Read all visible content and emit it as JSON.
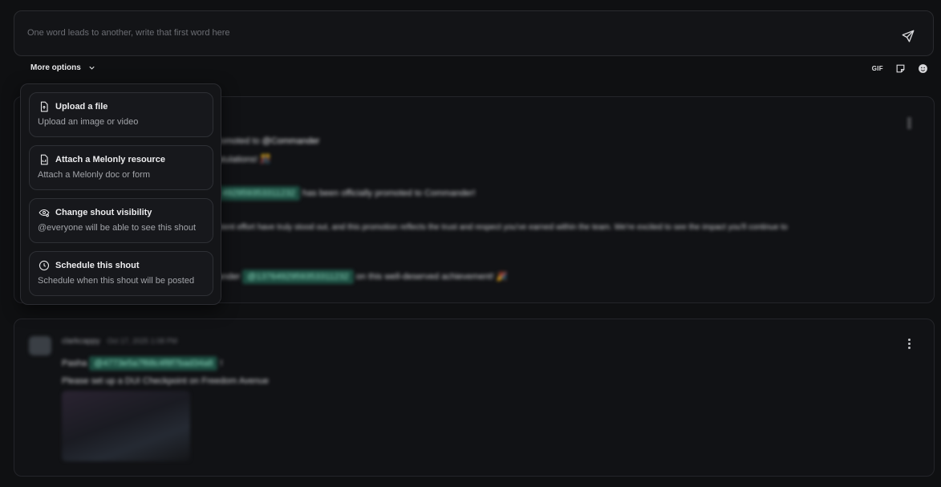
{
  "composer": {
    "placeholder": "One word leads to another, write that first word here"
  },
  "toolbar": {
    "more_options_label": "More options",
    "gif_label": "GIF"
  },
  "menu": {
    "items": [
      {
        "title": "Upload a file",
        "description": "Upload an image or video",
        "icon": "file-upload-icon"
      },
      {
        "title": "Attach a Melonly resource",
        "description": "Attach a Melonly doc or form",
        "icon": "document-icon"
      },
      {
        "title": "Change shout visibility",
        "description": "@everyone will be able to see this shout",
        "icon": "eye-settings-icon"
      },
      {
        "title": "Schedule this shout",
        "description": "Schedule when this shout will be posted",
        "icon": "clock-icon"
      }
    ]
  },
  "post1": {
    "line1_prefix": "romoted to",
    "line1_mention": "@Commander",
    "line2": "atulations! 🎊",
    "line3_mention": "492959353311232",
    "line3_suffix": "has been officially promoted to Commander!",
    "line4": "stent effort have truly stood out, and this promotion reflects the trust and respect you've earned within the team. We're excited to see the impact you'll continue to",
    "line5_prefix": "ander",
    "line5_mention": "@1376492959353311232",
    "line5_suffix": "on this well-deserved achievement! 🎉"
  },
  "post2": {
    "author": "clarkcappy",
    "timestamp": "Oct 17, 2025 1:08 PM",
    "line1_prefix": "Pasha",
    "line1_mention": "@4773e5a7f68c4f8f7bad34a8",
    "line1_suffix": "!",
    "line2": "Please set up a DUI Checkpoint on Freedom Avenue"
  }
}
